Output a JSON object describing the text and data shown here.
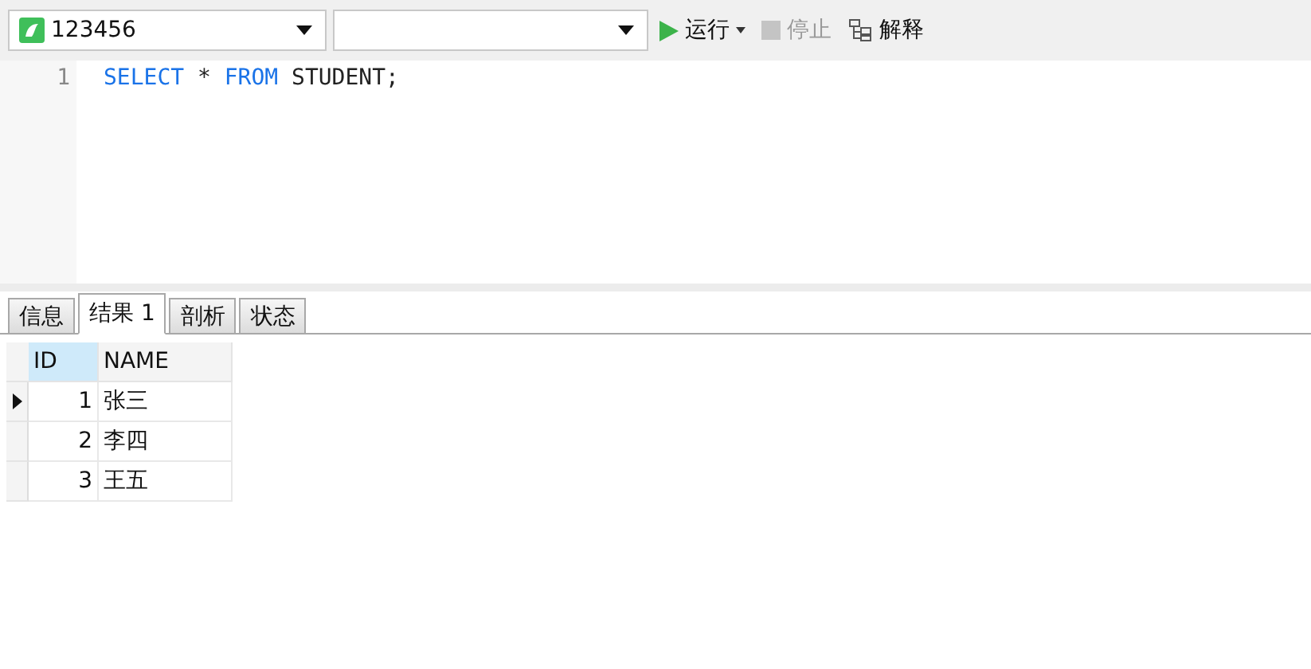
{
  "toolbar": {
    "connection": "123456",
    "buttons": [
      {
        "kind": "run",
        "label": "运行",
        "disabled": false
      },
      {
        "kind": "stop",
        "label": "停止",
        "disabled": true
      },
      {
        "kind": "explain",
        "label": "解释",
        "disabled": false
      }
    ]
  },
  "editor": {
    "lines": [
      {
        "number": "1",
        "tokens": [
          {
            "kind": "keyword",
            "text": "SELECT"
          },
          {
            "kind": "plain",
            "text": " * "
          },
          {
            "kind": "keyword",
            "text": "FROM"
          },
          {
            "kind": "plain",
            "text": " STUDENT;"
          }
        ]
      }
    ]
  },
  "tabs": [
    {
      "label": "信息",
      "selected": false
    },
    {
      "label": "结果 1",
      "selected": true
    },
    {
      "label": "剖析",
      "selected": false
    },
    {
      "label": "状态",
      "selected": false
    }
  ],
  "table": {
    "columns": [
      {
        "label": "ID",
        "selected": true
      },
      {
        "label": "NAME",
        "selected": false
      }
    ],
    "rows": [
      {
        "selected": true,
        "cells": [
          "1",
          "张三"
        ]
      },
      {
        "selected": false,
        "cells": [
          "2",
          "李四"
        ]
      },
      {
        "selected": false,
        "cells": [
          "3",
          "王五"
        ]
      }
    ]
  }
}
